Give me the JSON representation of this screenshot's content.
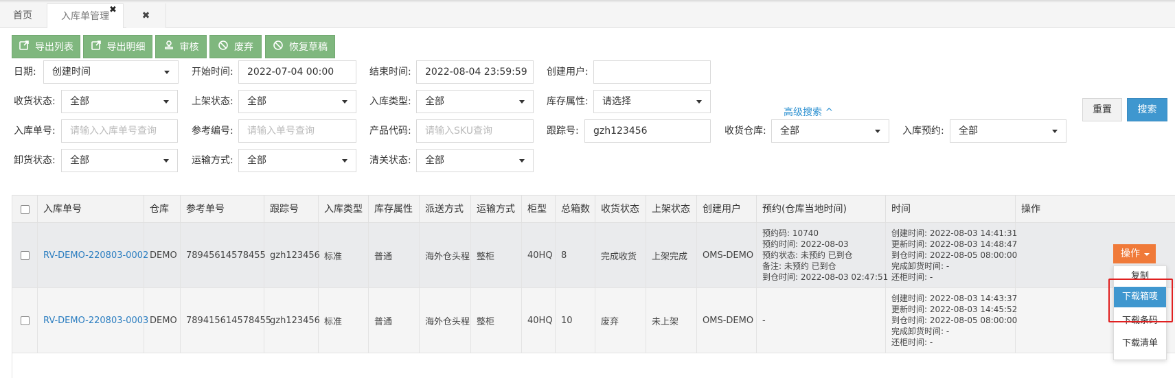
{
  "tabs": {
    "home": "首页",
    "inbound": "入库单管理",
    "close_small": "✖",
    "close": "✖"
  },
  "toolbar": [
    {
      "label": "导出列表",
      "icon": "export-icon"
    },
    {
      "label": "导出明细",
      "icon": "export-icon"
    },
    {
      "label": "审核",
      "icon": "stamp-icon"
    },
    {
      "label": "废弃",
      "icon": "ban-icon"
    },
    {
      "label": "恢复草稿",
      "icon": "ban-icon"
    }
  ],
  "filters": {
    "date_label": "日期:",
    "date_value": "创建时间",
    "start_label": "开始时间:",
    "start_value": "2022-07-04 00:00",
    "end_label": "结束时间:",
    "end_value": "2022-08-04 23:59:59",
    "creator_label": "创建用户:",
    "creator_value": "",
    "recv_status_label": "收货状态:",
    "recv_status_value": "全部",
    "shelf_status_label": "上架状态:",
    "shelf_status_value": "全部",
    "inbound_type_label": "入库类型:",
    "inbound_type_value": "全部",
    "stock_attr_label": "库存属性:",
    "stock_attr_value": "请选择",
    "advanced": "高级搜索 ^",
    "order_no_label": "入库单号:",
    "order_no_placeholder": "请输入入库单号查询",
    "ref_no_label": "参考编号:",
    "ref_no_placeholder": "请输入单号查询",
    "sku_label": "产品代码:",
    "sku_placeholder": "请输入SKU查询",
    "tracking_label": "跟踪号:",
    "tracking_value": "gzh123456",
    "warehouse_label": "收货仓库:",
    "warehouse_value": "全部",
    "reservation_label": "入库预约:",
    "reservation_value": "全部",
    "unload_label": "卸货状态:",
    "unload_value": "全部",
    "transport_label": "运输方式:",
    "transport_value": "全部",
    "customs_label": "清关状态:",
    "customs_value": "全部",
    "reset": "重置",
    "search": "搜索"
  },
  "table": {
    "headers": [
      "入库单号",
      "仓库",
      "参考单号",
      "跟踪号",
      "入库类型",
      "库存属性",
      "派送方式",
      "运输方式",
      "柜型",
      "总箱数",
      "收货状态",
      "上架状态",
      "创建用户",
      "预约(仓库当地时间)",
      "时间",
      "操作"
    ],
    "rows": [
      {
        "order_no": "RV-DEMO-220803-0002",
        "warehouse": "DEMO",
        "ref_no": "78945614578455",
        "tracking": "gzh123456",
        "type": "标准",
        "stock_attr": "普通",
        "delivery": "海外仓头程",
        "transport": "整柜",
        "container": "40HQ",
        "boxes": "8",
        "recv_status": "完成收货",
        "shelf_status": "上架完成",
        "creator": "OMS-DEMO",
        "reservation": [
          "预约码: 10740",
          "预约时间: 2022-08-03",
          "预约状态: 未预约 已到仓",
          "备注: 未预约 已到仓",
          "到仓时间: 2022-08-03 02:47:51"
        ],
        "times": [
          "创建时间: 2022-08-03 14:41:31",
          "更新时间: 2022-08-03 14:48:47",
          "到仓时间: 2022-08-05 08:00:00",
          "完成卸货时间: -",
          "还柜时间: -"
        ]
      },
      {
        "order_no": "RV-DEMO-220803-0003",
        "warehouse": "DEMO",
        "ref_no": "789415614578455",
        "tracking": "gzh123456",
        "type": "标准",
        "stock_attr": "普通",
        "delivery": "海外仓头程",
        "transport": "整柜",
        "container": "40HQ",
        "boxes": "10",
        "recv_status": "废弃",
        "shelf_status": "未上架",
        "creator": "OMS-DEMO",
        "reservation": [
          "-"
        ],
        "times": [
          "创建时间: 2022-08-03 14:43:37",
          "更新时间: 2022-08-03 14:45:52",
          "到仓时间: 2022-08-05 08:00:00",
          "完成卸货时间: -",
          "还柜时间: -"
        ]
      }
    ]
  },
  "ops": {
    "button": "操作",
    "menu": [
      "复制",
      "下载箱唛",
      "下载条码",
      "下载清单"
    ]
  },
  "colors": {
    "green_button": "#7fb77e",
    "primary": "#3f97cf",
    "ops_orange": "#f07a39",
    "link": "#2a7dc0",
    "highlight": "#e02020"
  }
}
